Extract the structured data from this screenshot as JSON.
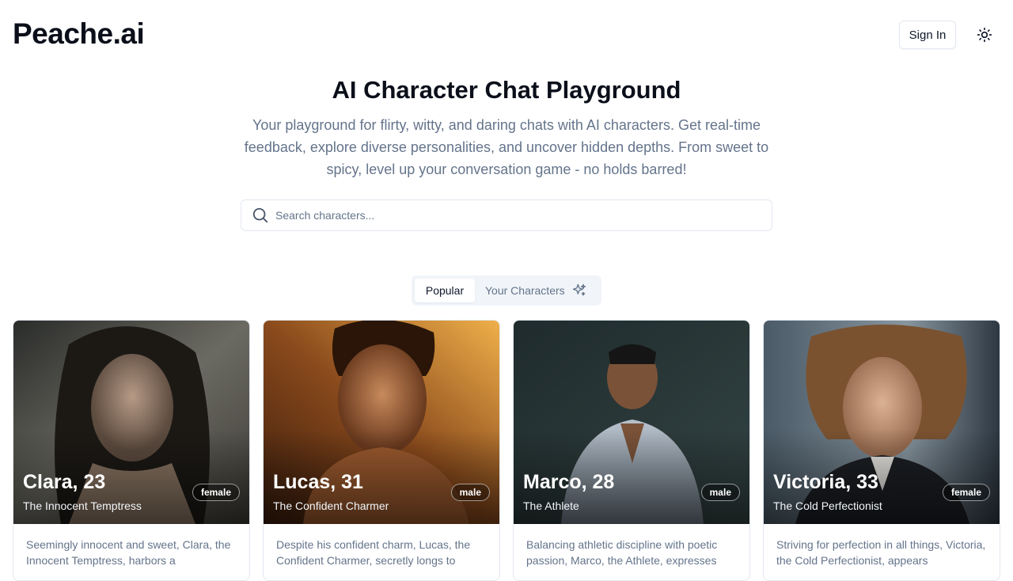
{
  "header": {
    "logo": "Peache.ai",
    "sign_in_label": "Sign In",
    "theme_icon": "sun-icon"
  },
  "hero": {
    "title": "AI Character Chat Playground",
    "subtitle": "Your playground for flirty, witty, and daring chats with AI characters. Get real-time feedback, explore diverse personalities, and uncover hidden depths. From sweet to spicy, level up your conversation game - no holds barred!"
  },
  "search": {
    "placeholder": "Search characters...",
    "value": "",
    "icon": "search-icon"
  },
  "tabs": [
    {
      "label": "Popular",
      "active": true
    },
    {
      "label": "Your Characters",
      "active": false,
      "icon": "sparkles-icon"
    }
  ],
  "cards": [
    {
      "name": "Clara, 23",
      "role": "The Innocent Temptress",
      "gender": "female",
      "description": "Seemingly innocent and sweet, Clara, the Innocent Temptress, harbors a"
    },
    {
      "name": "Lucas, 31",
      "role": "The Confident Charmer",
      "gender": "male",
      "description": "Despite his confident charm, Lucas, the Confident Charmer, secretly longs to"
    },
    {
      "name": "Marco, 28",
      "role": "The Athlete",
      "gender": "male",
      "description": "Balancing athletic discipline with poetic passion, Marco, the Athlete, expresses"
    },
    {
      "name": "Victoria, 33",
      "role": "The Cold Perfectionist",
      "gender": "female",
      "description": "Striving for perfection in all things, Victoria, the Cold Perfectionist, appears"
    }
  ],
  "colors": {
    "text_primary": "#0f172a",
    "text_muted": "#64748b",
    "border": "#e2e8f0",
    "tab_bg": "#f1f5f9"
  }
}
